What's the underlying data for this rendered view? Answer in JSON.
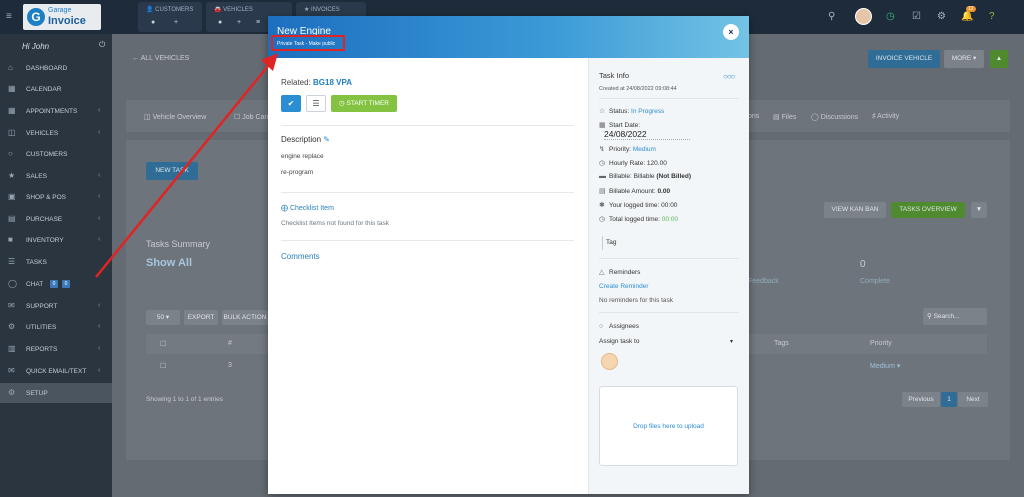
{
  "topbar": {
    "logo_small": "Garage",
    "logo_big": "Invoice",
    "nav": [
      {
        "label": "CUSTOMERS"
      },
      {
        "label": "VEHICLES"
      },
      {
        "label": "INVOICES"
      }
    ],
    "notification_count": "12"
  },
  "sidebar": {
    "greeting": "Hi John",
    "items": [
      {
        "label": "DASHBOARD",
        "icon": "home-icon"
      },
      {
        "label": "CALENDAR",
        "icon": "calendar-icon"
      },
      {
        "label": "APPOINTMENTS",
        "icon": "appointment-icon"
      },
      {
        "label": "VEHICLES",
        "icon": "car-icon"
      },
      {
        "label": "CUSTOMERS",
        "icon": "user-icon"
      },
      {
        "label": "SALES",
        "icon": "star-icon"
      },
      {
        "label": "SHOP & POS",
        "icon": "shop-icon"
      },
      {
        "label": "PURCHASE",
        "icon": "cart-icon"
      },
      {
        "label": "INVENTORY",
        "icon": "box-icon"
      },
      {
        "label": "TASKS",
        "icon": "tasks-icon"
      },
      {
        "label": "CHAT",
        "icon": "chat-icon"
      },
      {
        "label": "SUPPORT",
        "icon": "support-icon"
      },
      {
        "label": "UTILITIES",
        "icon": "cogs-icon"
      },
      {
        "label": "REPORTS",
        "icon": "chart-icon"
      },
      {
        "label": "QUICK EMAIL/TEXT",
        "icon": "mail-icon"
      },
      {
        "label": "SETUP",
        "icon": "gear-icon"
      }
    ],
    "chat_badges": [
      "0",
      "0"
    ]
  },
  "background": {
    "all_vehicles": "ALL VEHICLES",
    "invoice_vehicle": "INVOICE VEHICLE",
    "more": "MORE",
    "tab_overview": "Vehicle Overview",
    "tab_jobcards": "Job Cards",
    "tab_ons": "ons",
    "tab_files": "Files",
    "tab_discussions": "Discussions",
    "tab_activity": "Activity",
    "new_task": "NEW TASK",
    "view_kanban": "VIEW KAN BAN",
    "tasks_overview": "TASKS OVERVIEW",
    "tasks_summary": "Tasks Summary",
    "show_all": "Show All",
    "feedback": "Feedback",
    "zero": "0",
    "complete": "Complete",
    "page_size": "50",
    "export": "EXPORT",
    "bulk_actions": "BULK ACTION",
    "search_placeholder": "Search...",
    "col_hash": "#",
    "col_tags": "Tags",
    "col_priority": "Priority",
    "row_num": "3",
    "row_priority": "Medium",
    "showing": "Showing 1 to 1 of 1 entries",
    "previous": "Previous",
    "page": "1",
    "next": "Next"
  },
  "modal": {
    "title": "New Engine",
    "subtitle": "Private Task - Make public",
    "related_label": "Related:",
    "related_value": "BG18 VPA",
    "start_timer": "START TIMER",
    "description_label": "Description",
    "description_lines": [
      "engine replace",
      "re-program"
    ],
    "checklist_label": "Checklist Item",
    "checklist_empty": "Checklist Items not found for this task",
    "comments_label": "Comments",
    "task_info": {
      "title": "Task Info",
      "created": "Created at 24/08/2022 09:08:44",
      "status_label": "Status:",
      "status_value": "In Progress",
      "start_label": "Start Date:",
      "start_value": "24/08/2022",
      "priority_label": "Priority:",
      "priority_value": "Medium",
      "hourly_rate": "Hourly Rate: 120.00",
      "billable_label": "Billable: Billable",
      "billable_value": "(Not Billed)",
      "billable_amount_label": "Billable Amount:",
      "billable_amount_value": "0.00",
      "your_logged": "Your logged time: 00:00",
      "total_logged_label": "Total logged time:",
      "total_logged_value": "00:00",
      "tag_label": "Tag"
    },
    "reminders": {
      "title": "Reminders",
      "create": "Create Reminder",
      "empty": "No reminders for this task"
    },
    "assignees": {
      "title": "Assignees",
      "select": "Assign task to"
    },
    "dropzone": "Drop files here to upload"
  },
  "colors": {
    "accent_blue": "#2b8ed3",
    "timer_green": "#84c341",
    "highlight_red": "#e02424"
  }
}
